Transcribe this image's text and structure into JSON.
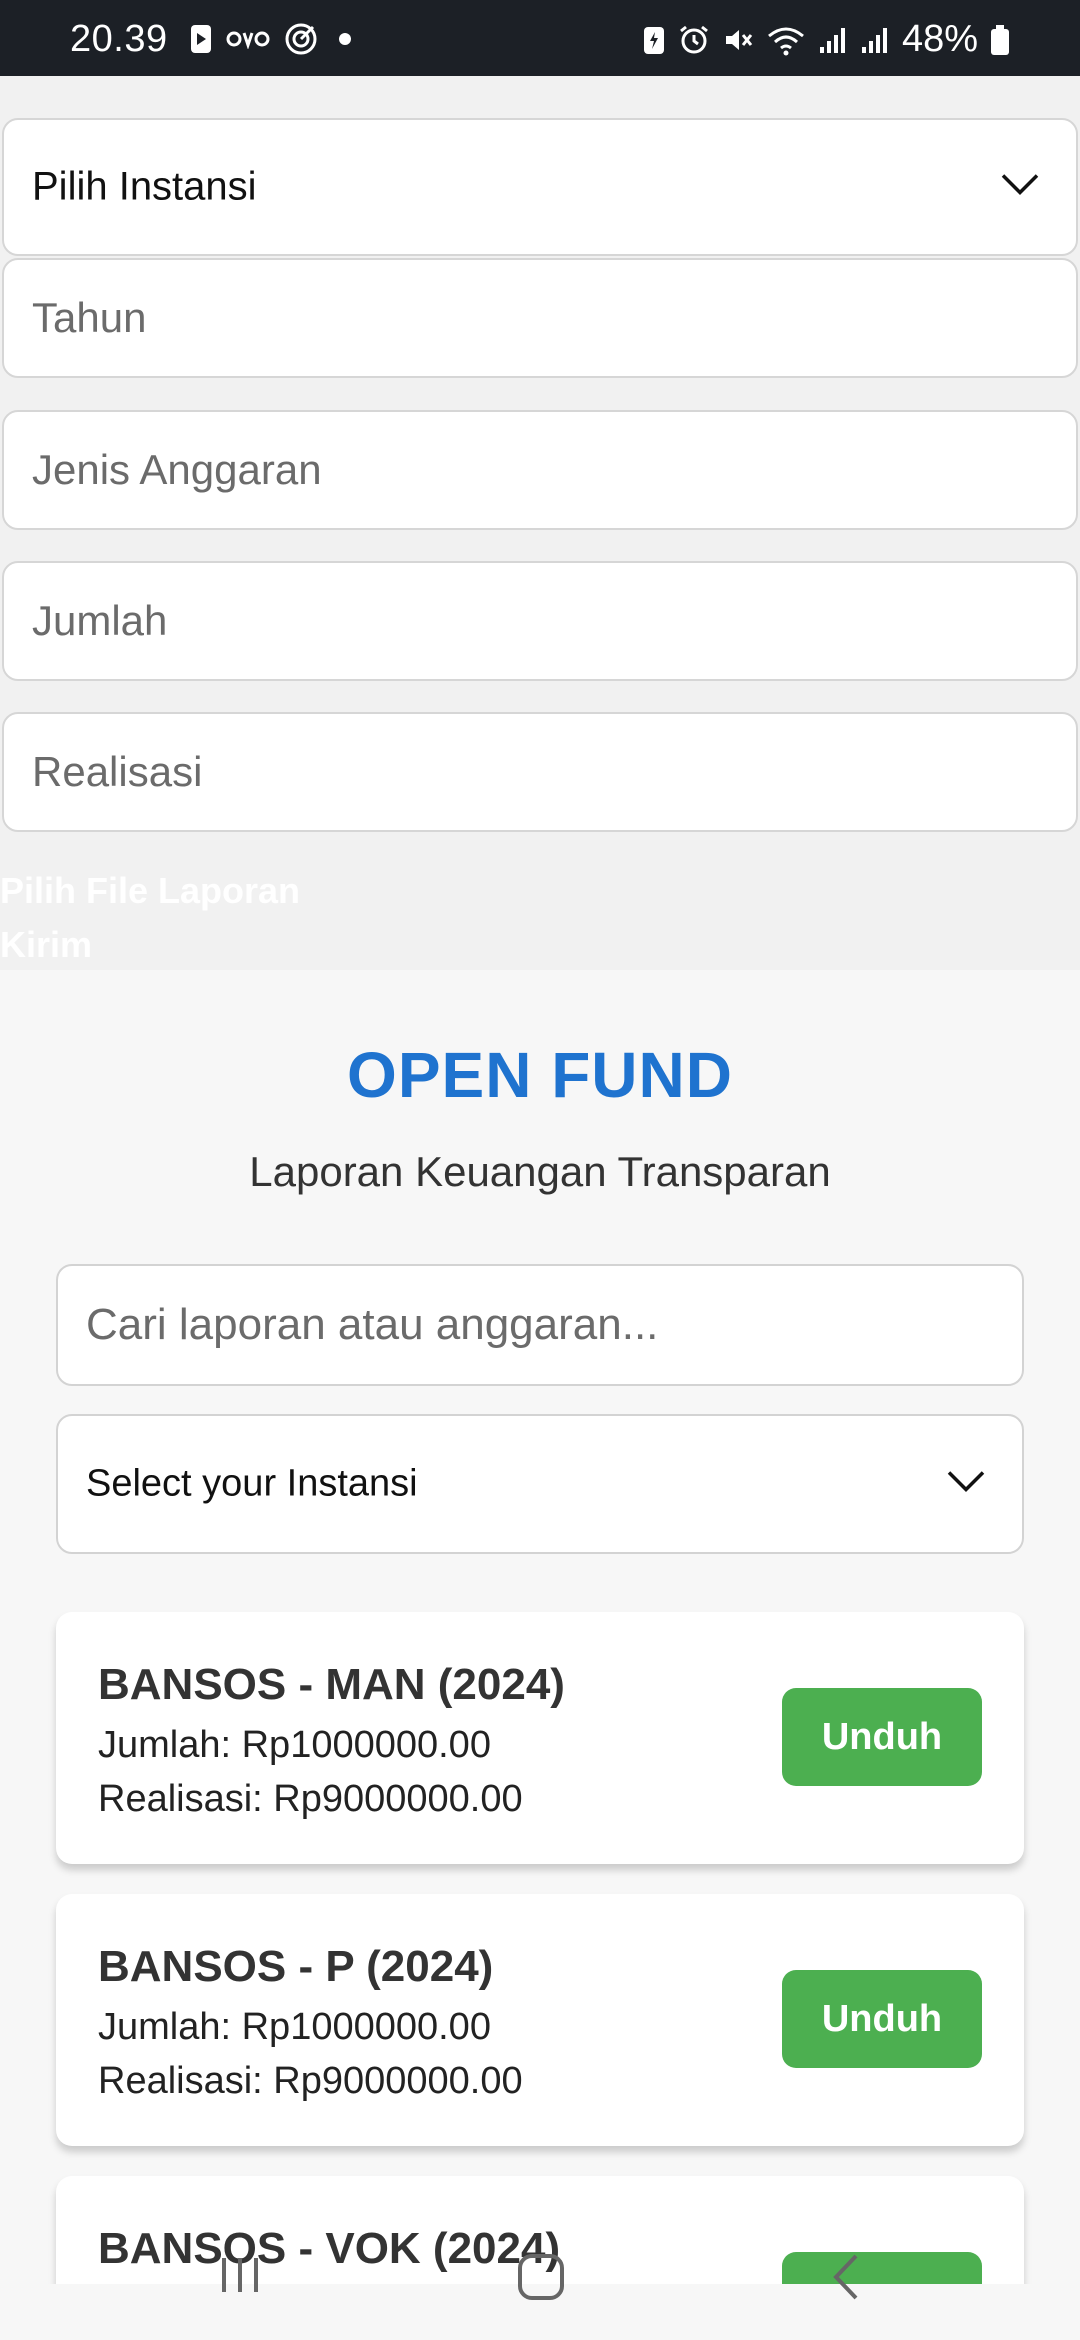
{
  "status_bar": {
    "time": "20.39",
    "app_icons": [
      "play-store-icon",
      "ovo-icon",
      "target-icon",
      "dot-icon"
    ],
    "system_icons": [
      "battery-saver-icon",
      "alarm-icon",
      "mute-icon",
      "wifi-icon",
      "signal-icon",
      "signal-icon",
      "battery-icon"
    ],
    "battery": "48%"
  },
  "upload_form": {
    "instansi_select": "Pilih Instansi",
    "tahun_placeholder": "Tahun",
    "jenis_placeholder": "Jenis Anggaran",
    "jumlah_placeholder": "Jumlah",
    "realisasi_placeholder": "Realisasi",
    "file_label": "Pilih File Laporan",
    "submit_label": "Kirim"
  },
  "main": {
    "title": "OPEN FUND",
    "subtitle": "Laporan Keuangan Transparan",
    "search_placeholder": "Cari laporan atau anggaran...",
    "instansi_filter": "Select your Instansi",
    "reports": [
      {
        "title": "BANSOS - MAN (2024)",
        "jumlah": "Jumlah: Rp1000000.00",
        "realisasi": "Realisasi: Rp9000000.00",
        "button": "Unduh"
      },
      {
        "title": "BANSOS - P (2024)",
        "jumlah": "Jumlah: Rp1000000.00",
        "realisasi": "Realisasi: Rp9000000.00",
        "button": "Unduh"
      },
      {
        "title": "BANSOS - VOK (2024)",
        "jumlah": "",
        "realisasi": "",
        "button": ""
      }
    ]
  },
  "colors": {
    "brand": "#1f73cf",
    "button": "#4caf50",
    "status_bar": "#1c2026"
  }
}
